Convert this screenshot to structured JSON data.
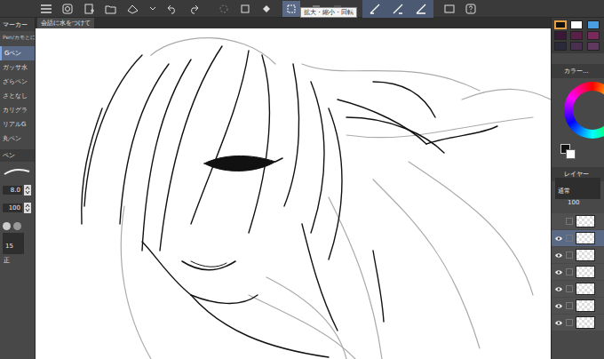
{
  "toolbar": {
    "tooltip": "拡大・縮小・回転"
  },
  "document_tab": {
    "label": "会話に水をつけて"
  },
  "tool_palette": {
    "title": "マーカー",
    "group": "Pen/カモとに",
    "items": [
      {
        "label": "Gペン",
        "selected": true
      },
      {
        "label": "ガッサ水",
        "selected": false
      },
      {
        "label": "ざらペン",
        "selected": false
      },
      {
        "label": "さとなし",
        "selected": false
      },
      {
        "label": "カリグラ",
        "selected": false
      },
      {
        "label": "リアルG",
        "selected": false
      },
      {
        "label": "丸ペン",
        "selected": false
      }
    ]
  },
  "tool_property": {
    "title": "ペン",
    "size": "8.0",
    "opacity": "100",
    "stabilization": "15",
    "correction": "正"
  },
  "color_panel": {
    "title": "カラー...",
    "swatches": [
      {
        "color": "#111111",
        "selected": true
      },
      {
        "color": "#ffffff",
        "selected": false
      },
      {
        "color": "#4a9fe0",
        "selected": false
      },
      {
        "color": "#3a1838",
        "selected": false
      },
      {
        "color": "#5a2048",
        "selected": false
      },
      {
        "color": "#7a2a5a",
        "selected": false
      },
      {
        "color": "#2a2a3a",
        "selected": false
      },
      {
        "color": "#4a3050",
        "selected": false
      },
      {
        "color": "#603860",
        "selected": false
      }
    ]
  },
  "layer_panel": {
    "title": "レイヤー",
    "blend": "通常",
    "opacity": "100",
    "layers": [
      {
        "visible": false,
        "selected": false
      },
      {
        "visible": true,
        "selected": true
      },
      {
        "visible": true,
        "selected": false
      },
      {
        "visible": true,
        "selected": false
      },
      {
        "visible": true,
        "selected": false
      },
      {
        "visible": true,
        "selected": false
      },
      {
        "visible": true,
        "selected": false
      }
    ]
  }
}
